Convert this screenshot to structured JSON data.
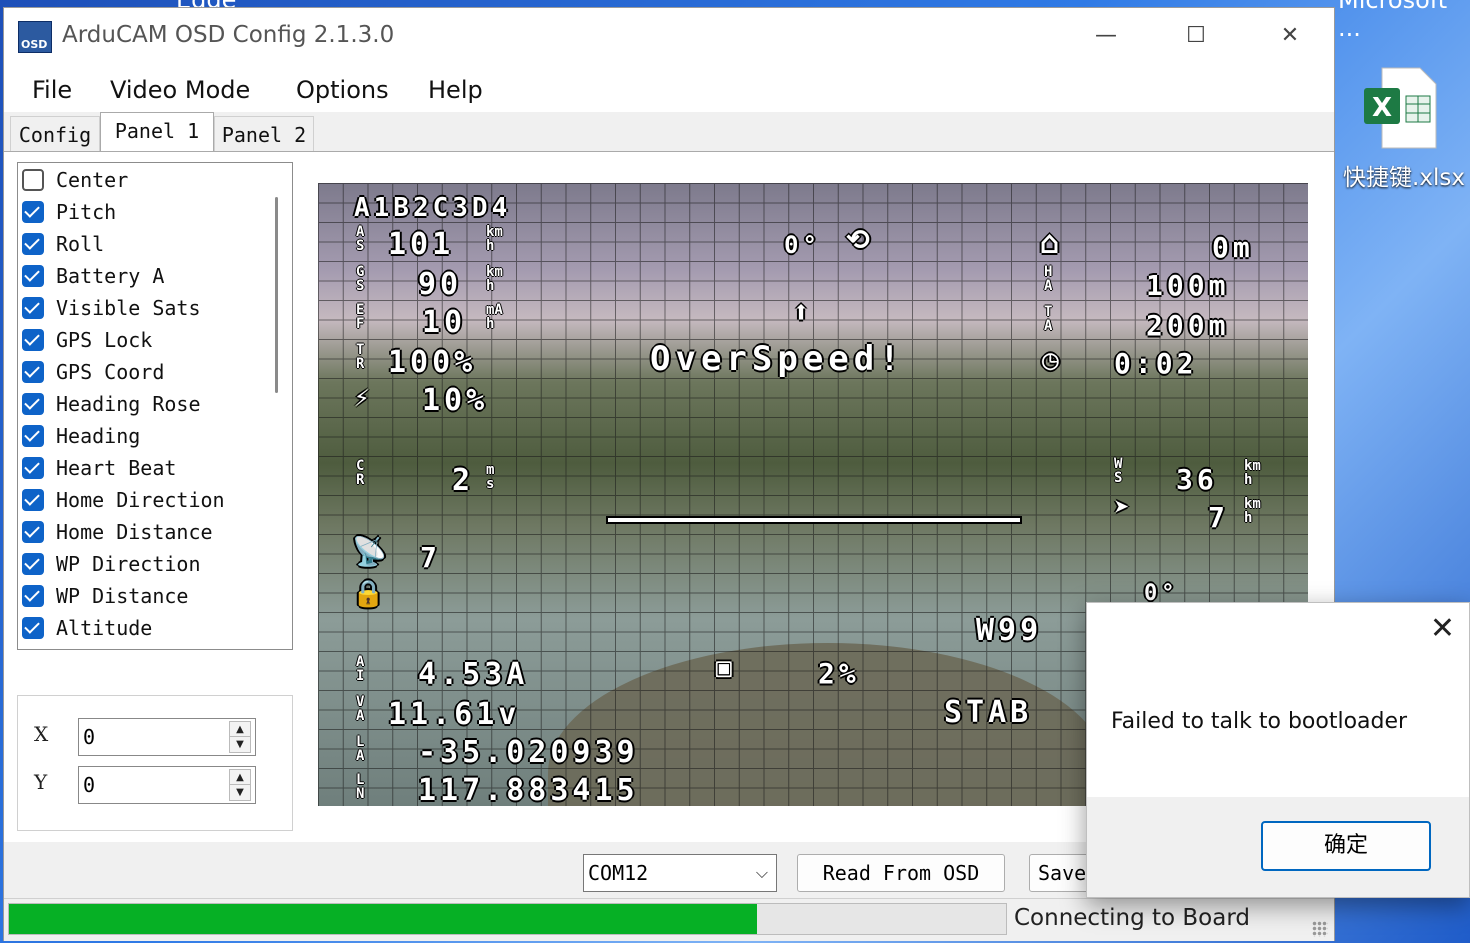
{
  "desktop": {
    "top_left_fragment": "Edge",
    "top_right_fragment": "Microsoft ...",
    "file_icon_label": "快捷键.xlsx",
    "file_icon_letter": "X"
  },
  "window": {
    "icon_text": "OSD",
    "title": "ArduCAM OSD Config 2.1.3.0",
    "minimize": "—",
    "maximize": "☐",
    "close": "✕"
  },
  "menu": [
    "File",
    "Video Mode",
    "Options",
    "Help"
  ],
  "tabs": [
    {
      "label": "Config",
      "active": false
    },
    {
      "label": "Panel 1",
      "active": true
    },
    {
      "label": "Panel 2",
      "active": false
    }
  ],
  "panel_items": [
    {
      "label": "Center",
      "checked": false
    },
    {
      "label": "Pitch",
      "checked": true
    },
    {
      "label": "Roll",
      "checked": true
    },
    {
      "label": "Battery A",
      "checked": true
    },
    {
      "label": "Visible Sats",
      "checked": true
    },
    {
      "label": "GPS Lock",
      "checked": true
    },
    {
      "label": "GPS Coord",
      "checked": true
    },
    {
      "label": "Heading Rose",
      "checked": true
    },
    {
      "label": "Heading",
      "checked": true
    },
    {
      "label": "Heart Beat",
      "checked": true
    },
    {
      "label": "Home Direction",
      "checked": true
    },
    {
      "label": "Home Distance",
      "checked": true
    },
    {
      "label": "WP Direction",
      "checked": true
    },
    {
      "label": "WP Distance",
      "checked": true
    },
    {
      "label": "Altitude",
      "checked": true
    }
  ],
  "position": {
    "x_label": "X",
    "x_value": "0",
    "y_label": "Y",
    "y_value": "0",
    "up": "▲",
    "down": "▼"
  },
  "osd": {
    "callsign": "A1B2C3D4",
    "as_label": "A\nS",
    "as_value": "101",
    "as_unit": "km\nh",
    "gs_label": "G\nS",
    "gs_value": "90",
    "gs_unit": "km\nh",
    "ef_label": "E\nF",
    "ef_value": "10",
    "ef_unit": "mA\nh",
    "thr_label": "T\nR",
    "thr_value": "100%",
    "curr_value": "10%",
    "pitch": "0°",
    "roll_icon": "⟲",
    "heading_arrow": "⬆",
    "home_icon": "⌂",
    "home_dist": "0m",
    "ha_label": "H\nA",
    "ha_value": "100m",
    "ta_label": "T\nA",
    "ta_value": "200m",
    "timer_icon": "◷",
    "timer_value": "0:02",
    "warning": "OverSpeed!",
    "climb_label": "C\nR",
    "climb_value": "2",
    "climb_unit": "m\ns",
    "ws_label": "W\nS",
    "ws_value": "36",
    "ws_unit": "km\nh",
    "ws_value2": "7",
    "ws_unit2": "km\nh",
    "sats_value": "7",
    "wp_dir": "0°",
    "wp_value": "W99",
    "bat_label": "A\nI",
    "bat_current": "4.53A",
    "bat_pct": "2%",
    "volt_label": "V\nA",
    "volt_value": "11.61v",
    "lat_label": "L\nA",
    "lat_value": "-35.020939",
    "lon_label": "L\nN",
    "lon_value": "117.883415",
    "mode_value": "STAB"
  },
  "bottom": {
    "port": "COM12",
    "read_button": "Read From OSD",
    "save_button": "Save"
  },
  "status": {
    "text": "Connecting to Board",
    "progress": 0.75
  },
  "dialog": {
    "close": "✕",
    "message": "Failed to talk to bootloader",
    "ok": "确定"
  },
  "colors": {
    "progress_green": "#06b025",
    "checkbox_blue": "#0e63c8",
    "dialog_accent": "#0067c0"
  }
}
